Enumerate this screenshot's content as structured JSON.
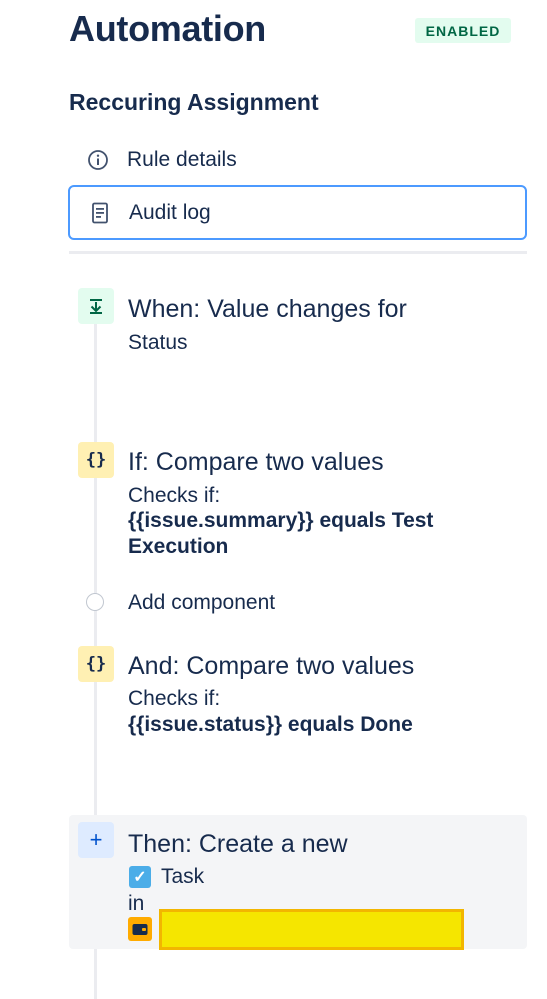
{
  "header": {
    "title": "Automation",
    "status_badge": "ENABLED"
  },
  "rule": {
    "name": "Reccuring Assignment"
  },
  "nav": {
    "items": [
      {
        "label": "Rule details",
        "icon": "info-icon"
      },
      {
        "label": "Audit log",
        "icon": "document-icon",
        "selected": true
      }
    ]
  },
  "steps": {
    "trigger": {
      "icon": "download-arrow-icon",
      "title": "When: Value changes for",
      "detail": "Status"
    },
    "condition1": {
      "icon": "braces-icon",
      "title": "If: Compare two values",
      "checks_label": "Checks if:",
      "expression_line1": "{{issue.summary}} equals Test",
      "expression_line2": "Execution"
    },
    "add_component": {
      "label": "Add component"
    },
    "condition2": {
      "icon": "braces-icon",
      "title": "And: Compare two values",
      "checks_label": "Checks if:",
      "expression": "{{issue.status}} equals Done"
    },
    "action": {
      "icon": "plus-icon",
      "title": "Then: Create a new",
      "issue_type": "Task",
      "in_label": "in"
    }
  },
  "colors": {
    "badge_bg": "#e3fcef",
    "badge_text": "#006644",
    "selected_border": "#4c9aff",
    "trigger_bg": "#e3fcef",
    "condition_bg": "#fff0b3",
    "action_bg": "#deebff",
    "redaction": "#f5e600"
  }
}
